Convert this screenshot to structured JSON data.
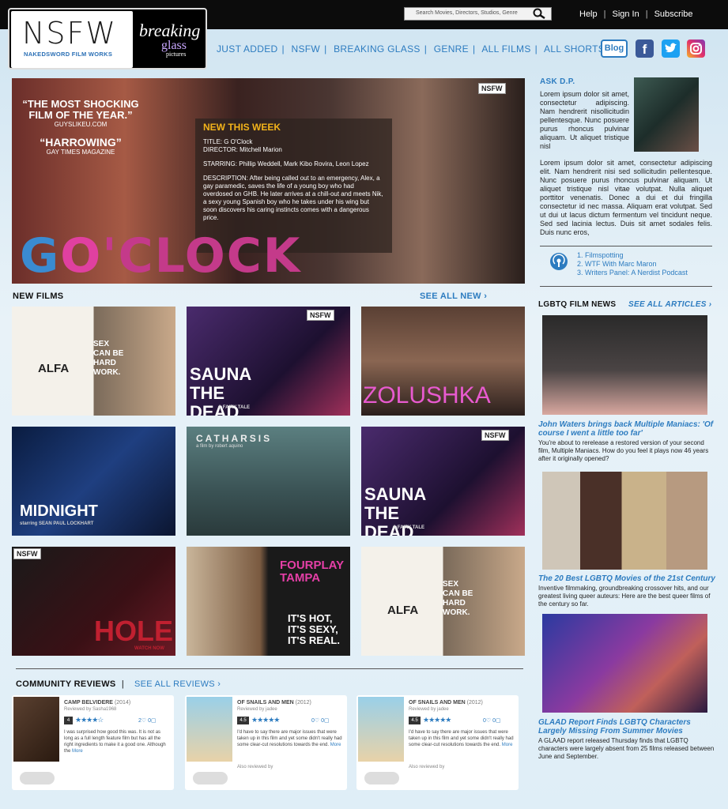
{
  "header": {
    "search_placeholder": "Search Movies, Directors, Studios, Genre",
    "links": [
      "Help",
      "Sign In",
      "Subscribe"
    ]
  },
  "logo": {
    "nsfw": "NSFW",
    "nsfw_sub": "NAKEDSWORD FILM WORKS",
    "bg_line1": "breaking",
    "bg_line2": "glass",
    "bg_line3": "pictures"
  },
  "nav": [
    "JUST ADDED",
    "NSFW",
    "BREAKING GLASS",
    "GENRE",
    "ALL FILMS",
    "ALL SHORTS"
  ],
  "social": {
    "blog": "Blog",
    "fb": "f"
  },
  "hero": {
    "quote1": "“THE MOST SHOCKING FILM OF THE YEAR.”",
    "quote1_src": "GUYSLIKEU.COM",
    "quote2": "“HARROWING”",
    "quote2_src": "GAY TIMES MAGAZINE",
    "tag": "NSFW",
    "heading": "NEW THIS WEEK",
    "title": "TITLE: G O'Clock",
    "director": "DIRECTOR: Mitchell Marion",
    "starring": "STARRING: Phillip Weddell, Mark Kibo Rovira, Leon Lopez",
    "description": "DESCRIPTION: After being called out to an emergency, Alex, a gay paramedic, saves the life of a young boy who had overdosed on GHB. He later arrives at a chill-out and meets Nik, a sexy young Spanish boy who he takes under his wing but soon discovers his caring instincts comes with a dangerous price.",
    "logo_g": "G",
    "logo_o": "O",
    "logo_rest": "'CLOCK"
  },
  "new_films": {
    "heading": "NEW FILMS",
    "see_all": "SEE ALL NEW ›",
    "tiles": [
      {
        "title": "ALFA",
        "overlay": "SEX CAN BE HARD WORK."
      },
      {
        "title": "SAUNA THE DEAD",
        "overlay": "A FAIRY TALE",
        "tag": "NSFW"
      },
      {
        "title": "ZOLUSHKA",
        "overlay": ""
      },
      {
        "title": "MIDNIGHT",
        "overlay": "starring SEAN PAUL LOCKHART"
      },
      {
        "title": "CATHARSIS",
        "overlay": "a film by robert aquino"
      },
      {
        "title": "SAUNA THE DEAD",
        "overlay": "A FAIRY TALE",
        "tag": "NSFW"
      },
      {
        "title": "HOLE",
        "overlay": "WATCH NOW",
        "tag": "NSFW"
      },
      {
        "title": "FOURPLAY TAMPA",
        "overlay": "IT'S HOT, IT'S SEXY, IT'S REAL."
      },
      {
        "title": "ALFA",
        "overlay": "SEX CAN BE HARD WORK."
      }
    ]
  },
  "ask": {
    "heading": "ASK D.P.",
    "text1": "Lorem ipsum dolor sit amet, consectetur adipiscing. Nam hendrerit nisollicitudin pellentesque. Nunc posuere purus rhoncus pulvinar aliquam. Ut aliquet tristique nisl",
    "text2": "Lorem ipsum dolor sit amet, consectetur adipiscing elit. Nam hendrerit nisi sed sollicitudin pellentesque. Nunc posuere purus rhoncus pulvinar aliquam. Ut aliquet tristique nisl vitae volutpat. Nulla aliquet porttitor venenatis. Donec a dui et dui fringilla consectetur id nec massa. Aliquam erat volutpat. Sed ut dui ut lacus dictum fermentum vel tincidunt neque. Sed sed lacinia lectus. Duis sit amet sodales felis. Duis nunc eros,"
  },
  "podcasts": [
    "1. Filmspotting",
    "2. WTF With Marc Maron",
    "3. Writers Panel: A Nerdist Podcast"
  ],
  "news": {
    "heading": "LGBTQ FILM NEWS",
    "see_all": "SEE ALL ARTICLES ›",
    "items": [
      {
        "title": "John Waters brings back Multiple Maniacs: 'Of course I went a little too far'",
        "desc": "You're about to rerelease a restored version of your second film, Multiple Maniacs. How do you feel it plays now 46 years after it originally opened?"
      },
      {
        "title": "The 20 Best LGBTQ Movies of the 21st Century",
        "desc": "Inventive filmmaking, groundbreaking crossover hits, and our greatest living queer auteurs: Here are the best queer films of the century so far."
      },
      {
        "title": "GLAAD Report Finds LGBTQ Characters Largely Missing From Summer Movies",
        "desc": "A GLAAD report released Thursday finds that LGBTQ characters were largely absent from 25 films released between June and September."
      }
    ]
  },
  "reviews": {
    "heading": "COMMUNITY REVIEWS",
    "see_all": "SEE ALL REVIEWS ›",
    "cards": [
      {
        "title": "CAMP BELVIDERE",
        "year": "(2014)",
        "reviewer": "Reviewed by Sasha1968",
        "score": "4",
        "stars": "★★★★☆",
        "likes": "2♡ 0▢",
        "body": "I was surprised how good this was. It is not as long as a full length feature film but has all the right ingredients to make it a good one. Although the",
        "more": "More",
        "also": ""
      },
      {
        "title": "OF SNAILS AND MEN",
        "year": "(2012)",
        "reviewer": "Reviewed by jadee",
        "score": "4.5",
        "stars": "★★★★★",
        "likes": "0♡ 0▢",
        "body": "I'd have to say there are major issues that were taken up in this film and yet some didn't really had some clear-cut resolutions towards the end.",
        "more": "More",
        "also": "Also reviewed by"
      },
      {
        "title": "OF SNAILS AND MEN",
        "year": "(2012)",
        "reviewer": "Reviewed by jadee",
        "score": "4.5",
        "stars": "★★★★★",
        "likes": "0♡ 0▢",
        "body": "I'd have to say there are major issues that were taken up in this film and yet some didn't really had some clear-cut resolutions towards the end.",
        "more": "More",
        "also": "Also reviewed by"
      }
    ]
  }
}
